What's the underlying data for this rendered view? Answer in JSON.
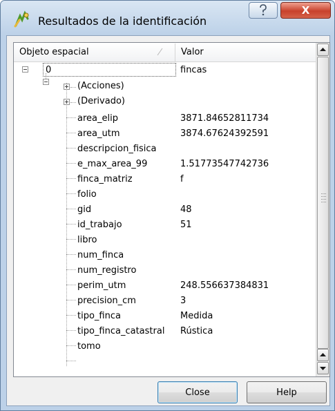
{
  "window": {
    "title": "Resultados de la identificación",
    "help_glyph": "?",
    "close_glyph": "X"
  },
  "table": {
    "col_feature": "Objeto espacial",
    "col_value": "Valor"
  },
  "tree": {
    "root": {
      "name": "0",
      "value": "fincas"
    },
    "groups": [
      {
        "name": "(Acciones)"
      },
      {
        "name": "(Derivado)"
      }
    ],
    "attributes": [
      {
        "name": "area_elip",
        "value": "3871.84652811734"
      },
      {
        "name": "area_utm",
        "value": "3874.67624392591"
      },
      {
        "name": "descripcion_fisica",
        "value": ""
      },
      {
        "name": "e_max_area_99",
        "value": "1.51773547742736"
      },
      {
        "name": "finca_matriz",
        "value": "f"
      },
      {
        "name": "folio",
        "value": ""
      },
      {
        "name": "gid",
        "value": "48"
      },
      {
        "name": "id_trabajo",
        "value": "51"
      },
      {
        "name": "libro",
        "value": ""
      },
      {
        "name": "num_finca",
        "value": ""
      },
      {
        "name": "num_registro",
        "value": ""
      },
      {
        "name": "perim_utm",
        "value": "248.556637384831"
      },
      {
        "name": "precision_cm",
        "value": "3"
      },
      {
        "name": "tipo_finca",
        "value": "Medida"
      },
      {
        "name": "tipo_finca_catastral",
        "value": "Rústica"
      },
      {
        "name": "tomo",
        "value": ""
      }
    ]
  },
  "buttons": {
    "close": "Close",
    "help": "Help"
  },
  "colors": {
    "title_bar": "#bcd1e8",
    "close_button": "#c8412c",
    "tree_background": "#ffffff"
  }
}
